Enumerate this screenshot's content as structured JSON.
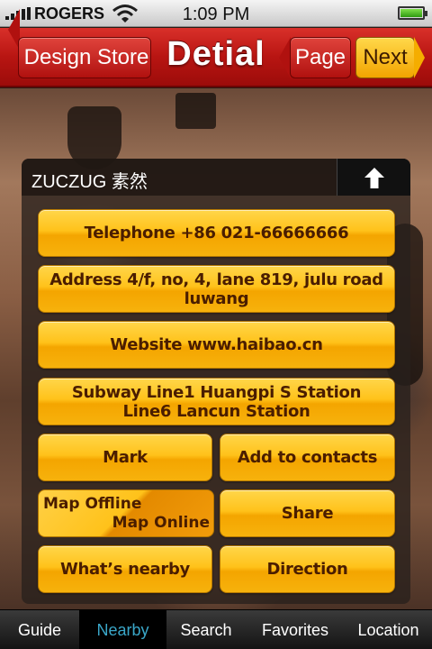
{
  "status_bar": {
    "carrier": "ROGERS",
    "time": "1:09 PM",
    "icons": [
      "signal-icon",
      "wifi-icon",
      "battery-icon"
    ]
  },
  "nav": {
    "back_label": "Design Store",
    "title": "Detial",
    "page_label": "Page",
    "next_label": "Next"
  },
  "store": {
    "name": "ZUCZUG 素然",
    "collapse_icon": "arrow-up-icon"
  },
  "details": {
    "telephone": "Telephone +86 021-66666666",
    "address": "Address 4/f, no, 4, lane 819, julu road luwang",
    "website": "Website www.haibao.cn",
    "subway_line1": "Subway Line1 Huangpi S Station",
    "subway_line2": "Line6 Lancun Station"
  },
  "actions": {
    "mark": "Mark",
    "add_contacts": "Add to contacts",
    "map_offline": "Map Offline",
    "map_online": "Map Online",
    "share": "Share",
    "whats_nearby": "What’s nearby",
    "direction": "Direction"
  },
  "tabs": [
    {
      "label": "Guide"
    },
    {
      "label": "Nearby"
    },
    {
      "label": "Search"
    },
    {
      "label": "Favorites"
    },
    {
      "label": "Location"
    }
  ],
  "colors": {
    "nav_red": "#b81512",
    "button_yellow": "#ffc21a",
    "active_tab": "#3aa7c9"
  }
}
